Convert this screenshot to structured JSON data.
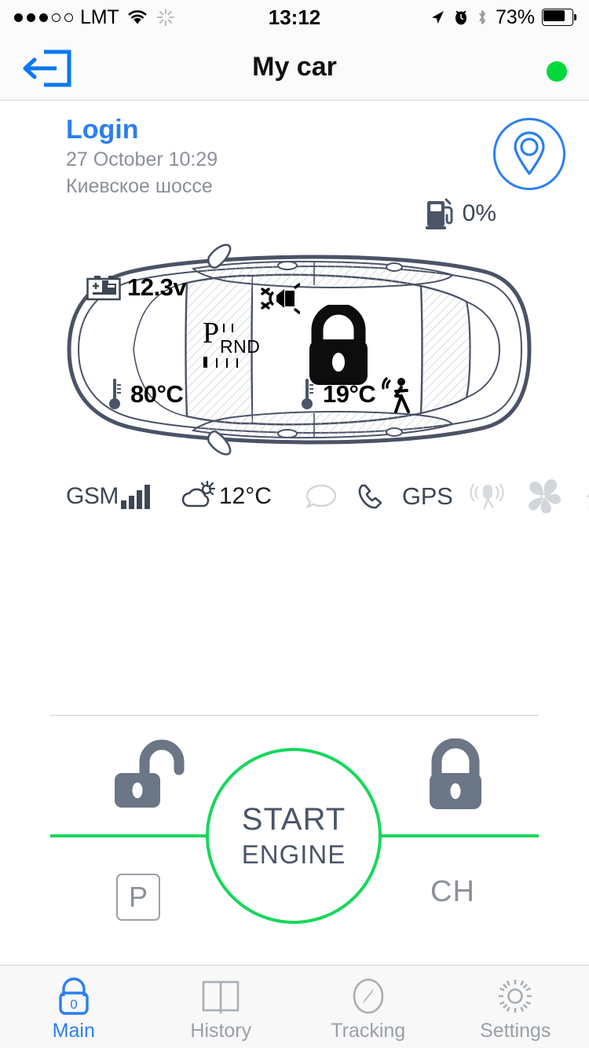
{
  "status_bar": {
    "carrier": "LMT",
    "signal_dots_filled": 3,
    "signal_dots_total": 5,
    "wifi_icon": "wifi-icon",
    "activity_icon": "activity-spinner-icon",
    "time": "13:12",
    "location_arrow_icon": "location-arrow-icon",
    "alarm_icon": "alarm-clock-icon",
    "bluetooth_icon": "bluetooth-icon",
    "battery_percent": "73%"
  },
  "navbar": {
    "title": "My car",
    "logout_icon": "logout-icon",
    "connection_status_color": "#00d83c"
  },
  "info": {
    "event": "Login",
    "datetime": "27 October 10:29",
    "address": "Киевское шоссе",
    "geo_icon": "map-pin-icon"
  },
  "fuel": {
    "icon": "fuel-pump-icon",
    "value": "0%"
  },
  "car": {
    "battery_voltage": "12.3v",
    "battery_icon": "car-battery-icon",
    "engine_temp": "80°C",
    "engine_temp_icon": "thermometer-icon",
    "cabin_temp": "19°C",
    "cabin_temp_icon": "thermometer-icon",
    "siren_icon": "siren-muted-icon",
    "shock_sensor_icon": "shock-sensor-icon",
    "lock_icon": "padlock-closed-icon",
    "gear_selected": "P",
    "gear_positions": [
      "P",
      "R",
      "N",
      "D"
    ]
  },
  "status_row": {
    "gsm_label": "GSM",
    "gsm_icon": "gsm-signal-icon",
    "gsm_bars_active": 4,
    "weather_icon": "cloud-sun-icon",
    "weather_temp": "12°C",
    "sms_icon": "sms-bubble-icon",
    "call_icon": "phone-handset-icon",
    "gps_label": "GPS",
    "beacon_icon": "beacon-antenna-icon",
    "fan_icon": "fan-icon",
    "heater_icon": "heater-arrows-icon"
  },
  "controls": {
    "unlock_icon": "padlock-open-icon",
    "lock_icon": "padlock-closed-icon",
    "start_line1": "START",
    "start_line2": "ENGINE",
    "parking_label": "P",
    "channel_label": "CH",
    "accent_green": "#16d85a"
  },
  "tabs": [
    {
      "label": "Main",
      "icon": "lock-zero-icon",
      "active": true
    },
    {
      "label": "History",
      "icon": "book-icon",
      "active": false
    },
    {
      "label": "Tracking",
      "icon": "compass-icon",
      "active": false
    },
    {
      "label": "Settings",
      "icon": "gear-icon",
      "active": false
    }
  ]
}
